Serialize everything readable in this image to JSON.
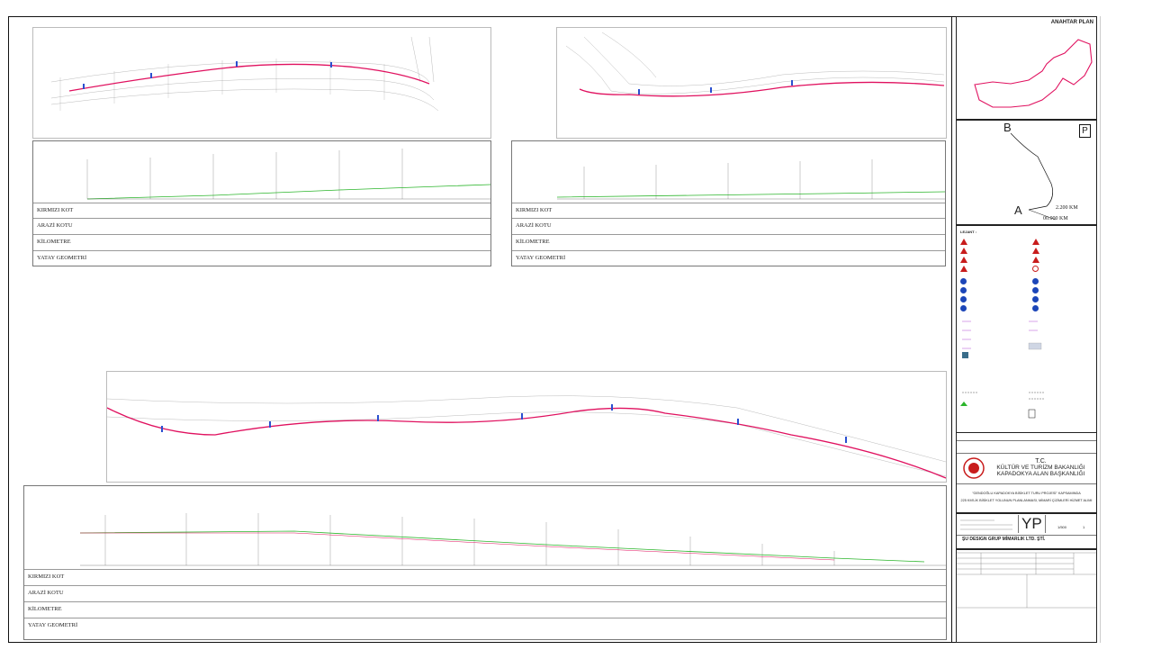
{
  "key_plan": {
    "title": "ANAHTAR PLAN"
  },
  "route_map": {
    "point_b": "B",
    "point_a": "A",
    "p_sign": "P",
    "km_end": "2.200 KM",
    "km_start": "00.000 KM"
  },
  "profile_rows": [
    "KIRMIZI KOT",
    "ARAZİ KOTU",
    "KİLOMETRE",
    "YATAY GEOMETRİ"
  ],
  "legend": {
    "title": "LEJANT :"
  },
  "institution": {
    "line1": "T.C.",
    "line2": "KÜLTÜR VE TURİZM BAKANLIĞI",
    "line3": "KAPADOKYA ALAN BAŞKANLIĞI"
  },
  "project_desc": {
    "line1": "\"GENDOĞLU KAPADOKYA BİSİKLET TURU PROJESİ\" KAPSAMINDA",
    "line2": "225 KM'LİK BİSİKLET YOLUNUN PLANLANMASI, MİMARİ ÇİZİMLERİ HİZMET ALIMI"
  },
  "drawing_code": {
    "code": "YP",
    "scale": "1/500",
    "page": "1"
  },
  "company": {
    "name": "ŞU DESIGN GRUP MİMARLIK LTD. ŞTİ."
  }
}
